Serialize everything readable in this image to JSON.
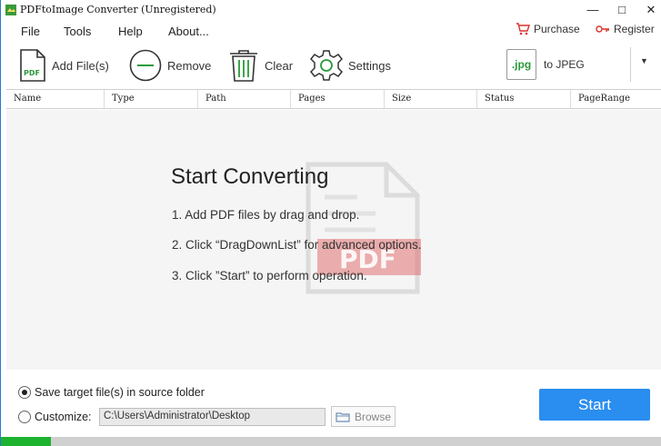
{
  "window": {
    "title": "PDFtoImage Converter (Unregistered)"
  },
  "menu": {
    "items": [
      "File",
      "Tools",
      "Help",
      "About..."
    ]
  },
  "links": {
    "purchase": "Purchase",
    "register": "Register"
  },
  "toolbar": {
    "add_files": "Add File(s)",
    "remove": "Remove",
    "clear": "Clear",
    "settings": "Settings",
    "format_badge": ".jpg",
    "format_label": "to JPEG"
  },
  "table": {
    "columns": [
      "Name",
      "Type",
      "Path",
      "Pages",
      "Size",
      "Status",
      "PageRange"
    ]
  },
  "main": {
    "heading": "Start Converting",
    "steps": [
      "1. Add PDF files by drag and drop.",
      "2. Click “DragDownList” for advanced options.",
      "3. Click ”Start” to perform operation."
    ],
    "watermark_text": "PDF"
  },
  "output": {
    "save_source_label": "Save target file(s) in source folder",
    "save_source_checked": true,
    "customize_label": "Customize:",
    "customize_checked": false,
    "path_value": "C:\\Users\\Administrator\\Desktop",
    "browse_label": "Browse",
    "start_label": "Start"
  },
  "progress": {
    "fraction": 0.075
  },
  "colors": {
    "accent": "#2a8df0",
    "progress": "#1db32f",
    "badge": "#2a9a3a",
    "watermark": "#e07070"
  }
}
